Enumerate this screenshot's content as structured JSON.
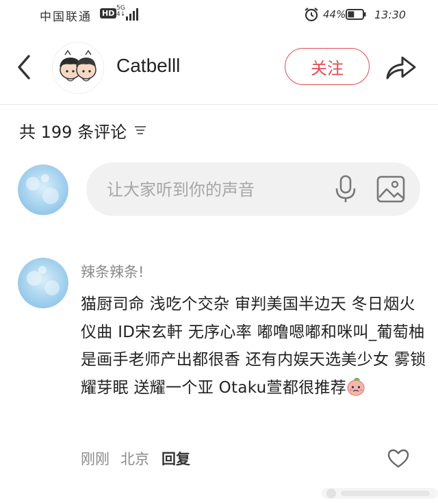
{
  "status_bar": {
    "carrier": "中国联通",
    "hd": "HD",
    "network_top": "5G",
    "network_bottom": "4↓",
    "battery_percent": "44%",
    "time": "13:30",
    "battery_level": 0.44
  },
  "header": {
    "username": "Catbelll",
    "follow_label": "关注",
    "back_icon": "chevron-left-icon",
    "share_icon": "share-arrow-icon"
  },
  "comments_summary": {
    "count_text": "共 199 条评论"
  },
  "input": {
    "placeholder": "让大家听到你的声音"
  },
  "comment": {
    "author": "辣条辣条!",
    "text": "猫厨司命 浅吃个交杂 审判美国半边天 冬日烟火仪曲 ID宋玄軒 无序心率 嘟噜嗯嘟和咪叫_葡萄柚是画手老师产出都很香 还有内娱天选美少女 雾锁耀芽眠 送耀一个亚 Otaku萱都很推荐",
    "time": "刚刚",
    "location": "北京",
    "reply_label": "回复"
  },
  "colors": {
    "accent": "#e14a52",
    "muted": "#8a8a8a",
    "input_bg": "#f1f1f1"
  }
}
